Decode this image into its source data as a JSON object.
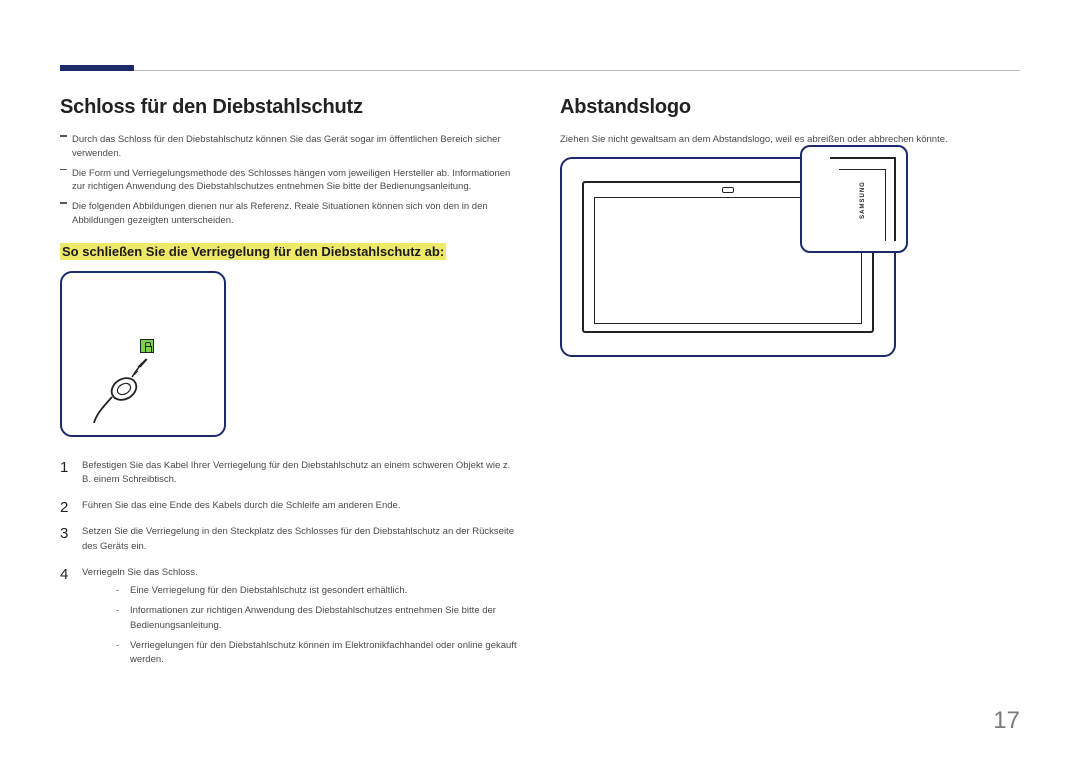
{
  "page_number": "17",
  "left": {
    "heading": "Schloss für den Diebstahlschutz",
    "notes": [
      "Durch das Schloss für den Diebstahlschutz können Sie das Gerät sogar im öffentlichen Bereich sicher verwenden.",
      "Die Form und Verriegelungsmethode des Schlosses hängen vom jeweiligen Hersteller ab. Informationen zur richtigen Anwendung des Diebstahlschutzes entnehmen Sie bitte der Bedienungsanleitung.",
      "Die folgenden Abbildungen dienen nur als Referenz. Reale Situationen können sich von den in den Abbildungen gezeigten unterscheiden."
    ],
    "subheading": "So schließen Sie die Verriegelung für den Diebstahlschutz ab:",
    "steps": [
      "Befestigen Sie das Kabel Ihrer Verriegelung für den Diebstahlschutz an einem schweren Objekt wie z. B. einem Schreibtisch.",
      "Führen Sie das eine Ende des Kabels durch die Schleife am anderen Ende.",
      "Setzen Sie die Verriegelung in den Steckplatz des Schlosses für den Diebstahlschutz an der Rückseite des Geräts ein.",
      "Verriegeln Sie das Schloss."
    ],
    "bullets": [
      "Eine Verriegelung für den Diebstahlschutz ist gesondert erhältlich.",
      "Informationen zur richtigen Anwendung des Diebstahlschutzes entnehmen Sie bitte der Bedienungsanleitung.",
      "Verriegelungen für den Diebstahlschutz können im Elektronikfachhandel oder online gekauft werden."
    ]
  },
  "right": {
    "heading": "Abstandslogo",
    "body": "Ziehen Sie nicht gewaltsam an dem Abstandslogo, weil es abreißen oder abbrechen könnte.",
    "brand": "SAMSUNG"
  }
}
